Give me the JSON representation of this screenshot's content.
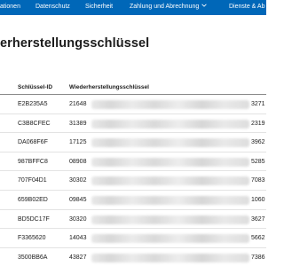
{
  "nav": {
    "items": [
      {
        "label": "ationen",
        "has_chevron": false
      },
      {
        "label": "Datenschutz",
        "has_chevron": false
      },
      {
        "label": "Sicherheit",
        "has_chevron": false
      },
      {
        "label": "Zahlung und Abrechnung",
        "has_chevron": true
      },
      {
        "label": "Dienste & Ab",
        "has_chevron": false
      }
    ],
    "background": "#0067b8"
  },
  "page": {
    "title": "erherstellungsschlüssel"
  },
  "table": {
    "headers": {
      "id": "Schlüssel-ID",
      "key": "Wiederherstellungsschlüssel"
    },
    "rows": [
      {
        "id": "E2B235A5",
        "key_prefix": "21648",
        "key_suffix": "3271"
      },
      {
        "id": "C3B8CFEC",
        "key_prefix": "31389",
        "key_suffix": "2319"
      },
      {
        "id": "DA068F6F",
        "key_prefix": "17125",
        "key_suffix": "3962"
      },
      {
        "id": "987BFFC8",
        "key_prefix": "08908",
        "key_suffix": "5285"
      },
      {
        "id": "707F04D1",
        "key_prefix": "30302",
        "key_suffix": "7083"
      },
      {
        "id": "659B02ED",
        "key_prefix": "09845",
        "key_suffix": "1060"
      },
      {
        "id": "BD5DC17F",
        "key_prefix": "30320",
        "key_suffix": "3627"
      },
      {
        "id": "F3365620",
        "key_prefix": "14043",
        "key_suffix": "5662"
      },
      {
        "id": "3500BB6A",
        "key_prefix": "43827",
        "key_suffix": "7386"
      }
    ]
  }
}
